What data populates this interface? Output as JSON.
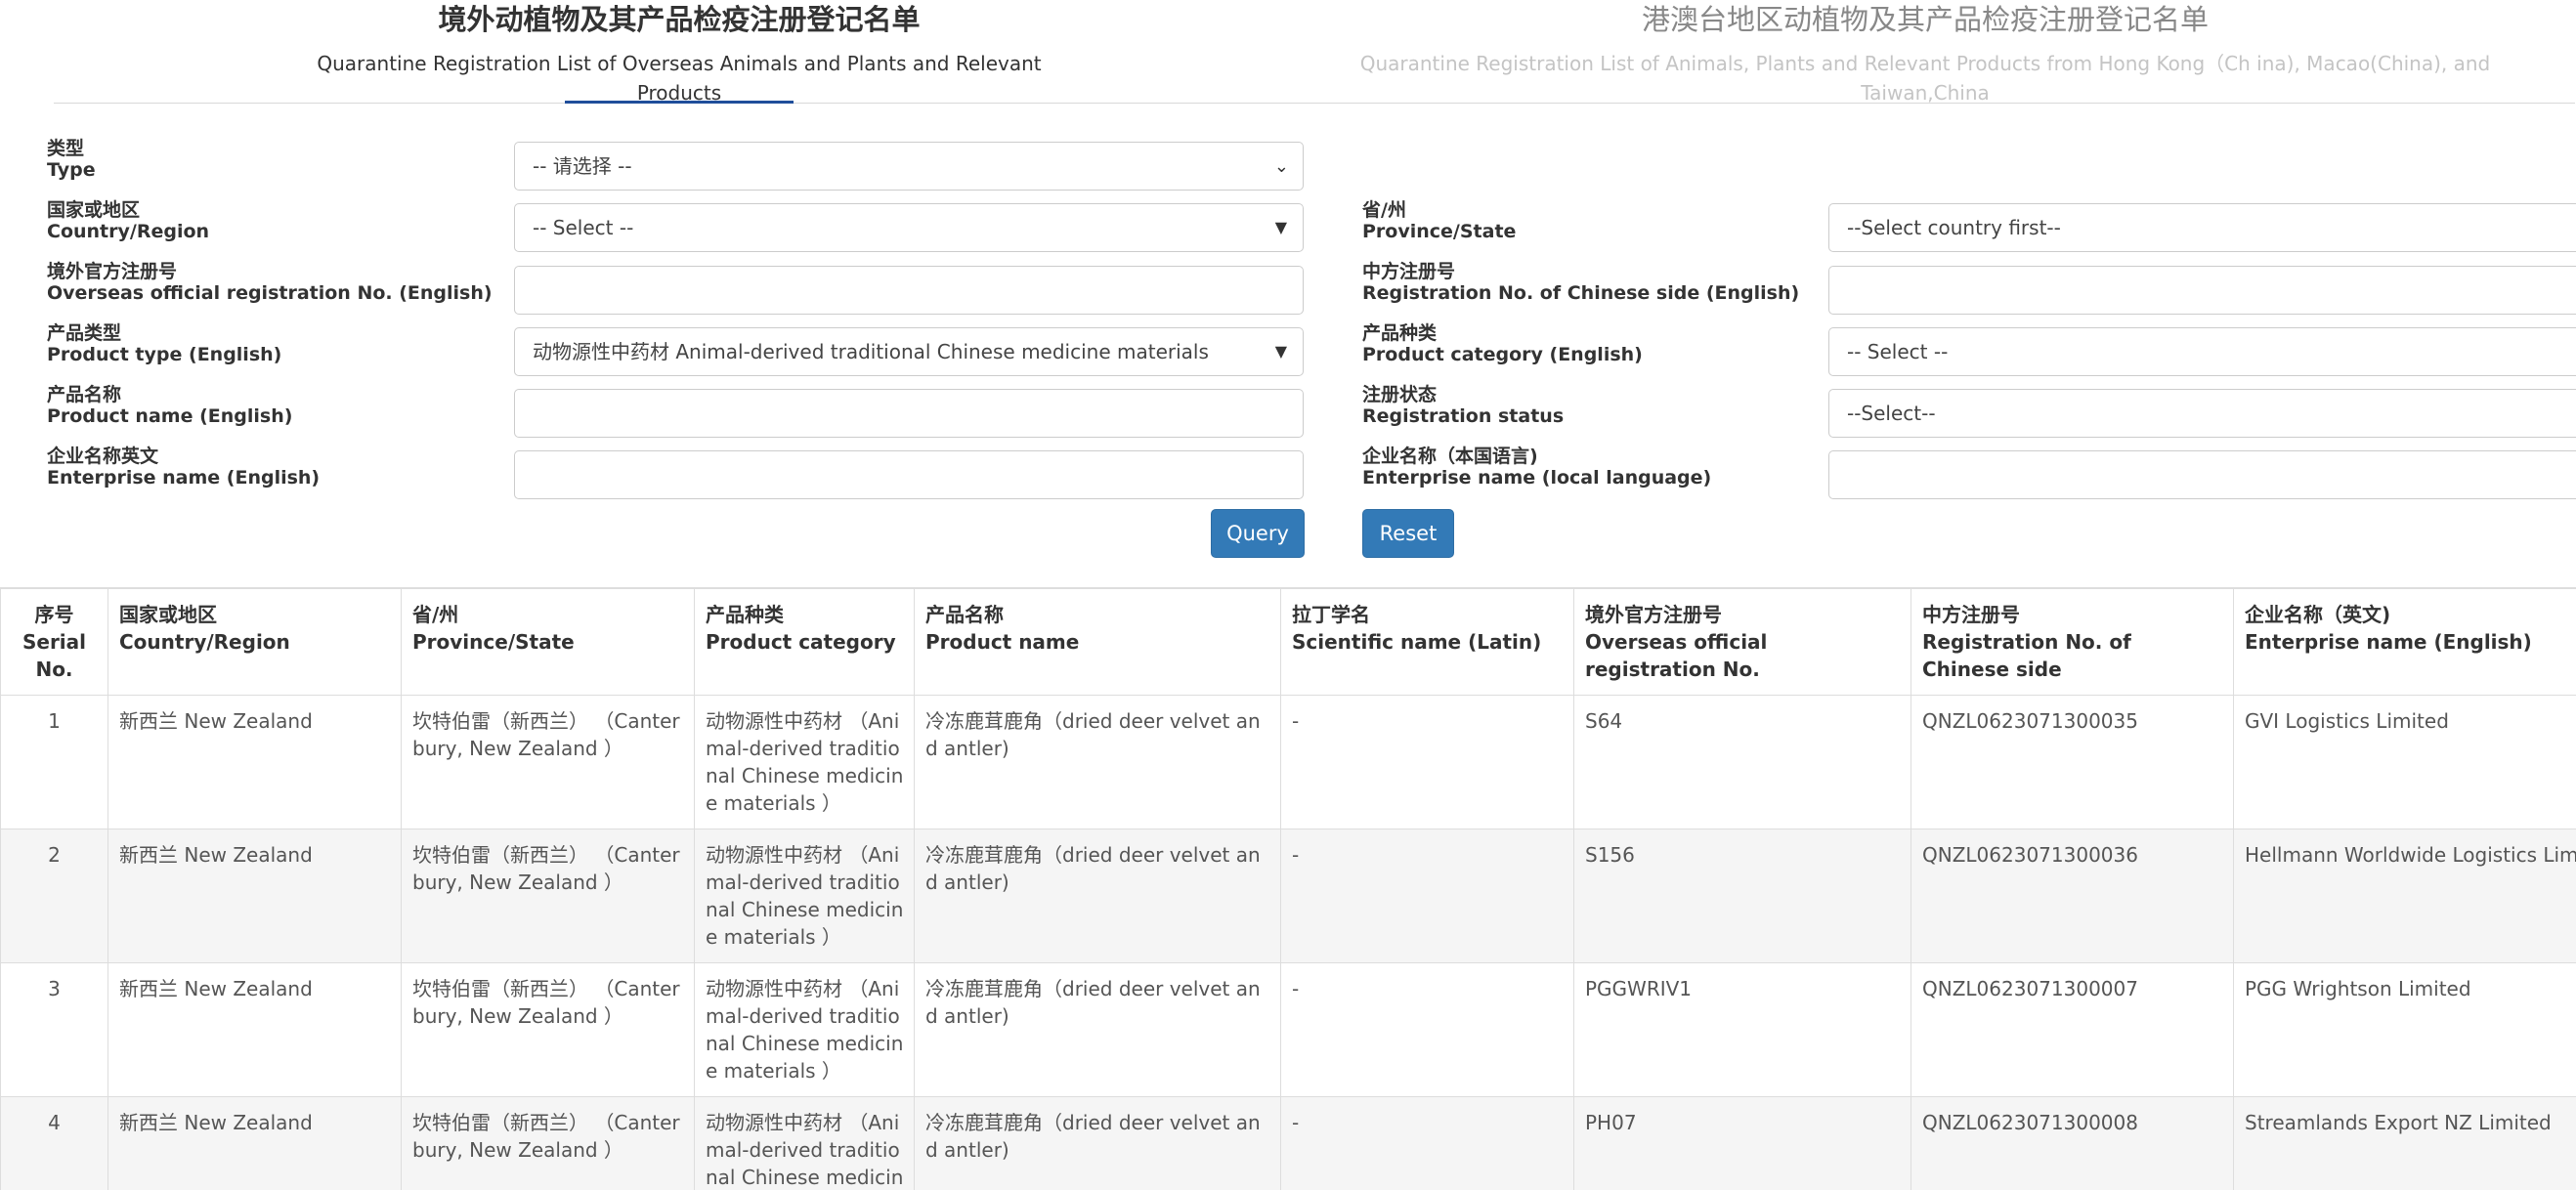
{
  "tabs": {
    "overseas": {
      "title_zh": "境外动植物及其产品检疫注册登记名单",
      "title_en": "Quarantine Registration List of Overseas Animals and Plants and Relevant Products"
    },
    "hmt": {
      "title_zh": "港澳台地区动植物及其产品检疫注册登记名单",
      "title_en": "Quarantine Registration List of Animals, Plants and Relevant Products from Hong Kong（Ch ina), Macao(China), and Taiwan,China"
    }
  },
  "form": {
    "type": {
      "label_zh": "类型",
      "label_en": "Type",
      "value": "-- 请选择 --"
    },
    "country": {
      "label_zh": "国家或地区",
      "label_en": "Country/Region",
      "value": "-- Select --"
    },
    "province": {
      "label_zh": "省/州",
      "label_en": "Province/State",
      "value": "--Select country first--"
    },
    "overseas_reg": {
      "label_zh": "境外官方注册号",
      "label_en": "Overseas official registration No. (English)",
      "value": ""
    },
    "chinese_reg": {
      "label_zh": "中方注册号",
      "label_en": "Registration No. of Chinese side (English)",
      "value": ""
    },
    "product_type": {
      "label_zh": "产品类型",
      "label_en": "Product type (English)",
      "value": "动物源性中药材 Animal-derived traditional Chinese medicine materials"
    },
    "product_category": {
      "label_zh": "产品种类",
      "label_en": "Product category (English)",
      "value": "-- Select --"
    },
    "product_name": {
      "label_zh": "产品名称",
      "label_en": "Product name (English)",
      "value": ""
    },
    "reg_status": {
      "label_zh": "注册状态",
      "label_en": "Registration status",
      "value": "--Select--"
    },
    "enterprise_en": {
      "label_zh": "企业名称英文",
      "label_en": "Enterprise name (English)",
      "value": ""
    },
    "enterprise_local": {
      "label_zh": "企业名称（本国语言)",
      "label_en": "Enterprise name (local language)",
      "value": ""
    },
    "query_label": "Query",
    "reset_label": "Reset"
  },
  "table": {
    "headers": [
      {
        "zh": "序号",
        "en": "Serial No."
      },
      {
        "zh": "国家或地区",
        "en": "Country/Region"
      },
      {
        "zh": "省/州",
        "en": "Province/State"
      },
      {
        "zh": "产品种类",
        "en": "Product category"
      },
      {
        "zh": "产品名称",
        "en": "Product name"
      },
      {
        "zh": "拉丁学名",
        "en": "Scientific name (Latin)"
      },
      {
        "zh": "境外官方注册号",
        "en": "Overseas official registration No."
      },
      {
        "zh": "中方注册号",
        "en": "Registration No. of Chinese side"
      },
      {
        "zh": "企业名称（英文)",
        "en": "Enterprise name (English)"
      }
    ],
    "rows": [
      [
        "1",
        "新西兰 New Zealand",
        "坎特伯雷（新西兰） （Canterbury, New Zealand ）",
        "动物源性中药材 （Animal-derived traditional Chinese medicine materials ）",
        "冷冻鹿茸鹿角（dried deer velvet and antler)",
        "-",
        "S64",
        "QNZL0623071300035",
        "GVI Logistics Limited"
      ],
      [
        "2",
        "新西兰 New Zealand",
        "坎特伯雷（新西兰） （Canterbury, New Zealand ）",
        "动物源性中药材 （Animal-derived traditional Chinese medicine materials ）",
        "冷冻鹿茸鹿角（dried deer velvet and antler)",
        "-",
        "S156",
        "QNZL0623071300036",
        "Hellmann Worldwide Logistics Limited"
      ],
      [
        "3",
        "新西兰 New Zealand",
        "坎特伯雷（新西兰） （Canterbury, New Zealand ）",
        "动物源性中药材 （Animal-derived traditional Chinese medicine materials ）",
        "冷冻鹿茸鹿角（dried deer velvet and antler)",
        "-",
        "PGGWRIV1",
        "QNZL0623071300007",
        "PGG Wrightson Limited"
      ],
      [
        "4",
        "新西兰 New Zealand",
        "坎特伯雷（新西兰） （Canterbury, New Zealand ）",
        "动物源性中药材 （Animal-derived traditional Chinese medicine materials ）",
        "冷冻鹿茸鹿角（dried deer velvet and antler)",
        "-",
        "PH07",
        "QNZL0623071300008",
        "Streamlands Export NZ Limited"
      ]
    ]
  }
}
